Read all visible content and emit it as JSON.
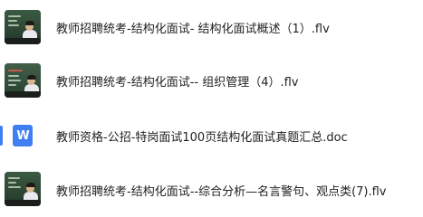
{
  "files": [
    {
      "name": "教师招聘统考-结构化面试- 结构化面试概述（1）.flv",
      "type": "video",
      "icon": "video-thumbnail"
    },
    {
      "name": "教师招聘统考-结构化面试-- 组织管理（4）.flv",
      "type": "video",
      "icon": "video-thumbnail"
    },
    {
      "name": "教师资格-公招-特岗面试100页结构化面试真题汇总.doc",
      "type": "document",
      "icon": "word-doc-icon",
      "icon_letter": "W",
      "icon_color": "#3f7ff3"
    },
    {
      "name": "教师招聘统考-结构化面试--综合分析—名言警句、观点类(7).flv",
      "type": "video",
      "icon": "video-thumbnail"
    }
  ]
}
